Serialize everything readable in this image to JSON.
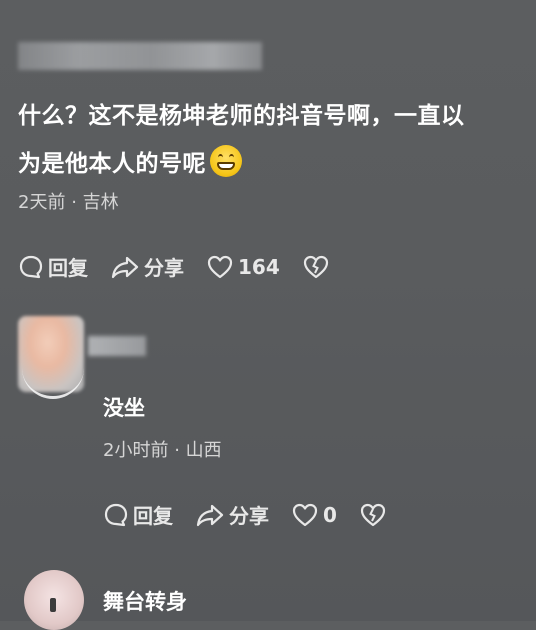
{
  "comment": {
    "text_line1": "什么？这不是杨坤老师的抖音号啊，一直以",
    "text_line2": "为是他本人的号呢",
    "emoji": "grinning-face",
    "time": "2天前",
    "location": "吉林",
    "separator": "·",
    "reply_label": "回复",
    "share_label": "分享",
    "like_count": "164"
  },
  "reply": {
    "name": "没坐",
    "time": "2小时前",
    "location": "山西",
    "separator": "·",
    "reply_label": "回复",
    "share_label": "分享",
    "like_count": "0"
  },
  "next_comment": {
    "name": "舞台转身"
  },
  "colors": {
    "background": "#5a5c5e",
    "text": "#ffffff",
    "meta": "#d6d6d6",
    "emoji": "#f5c518"
  }
}
